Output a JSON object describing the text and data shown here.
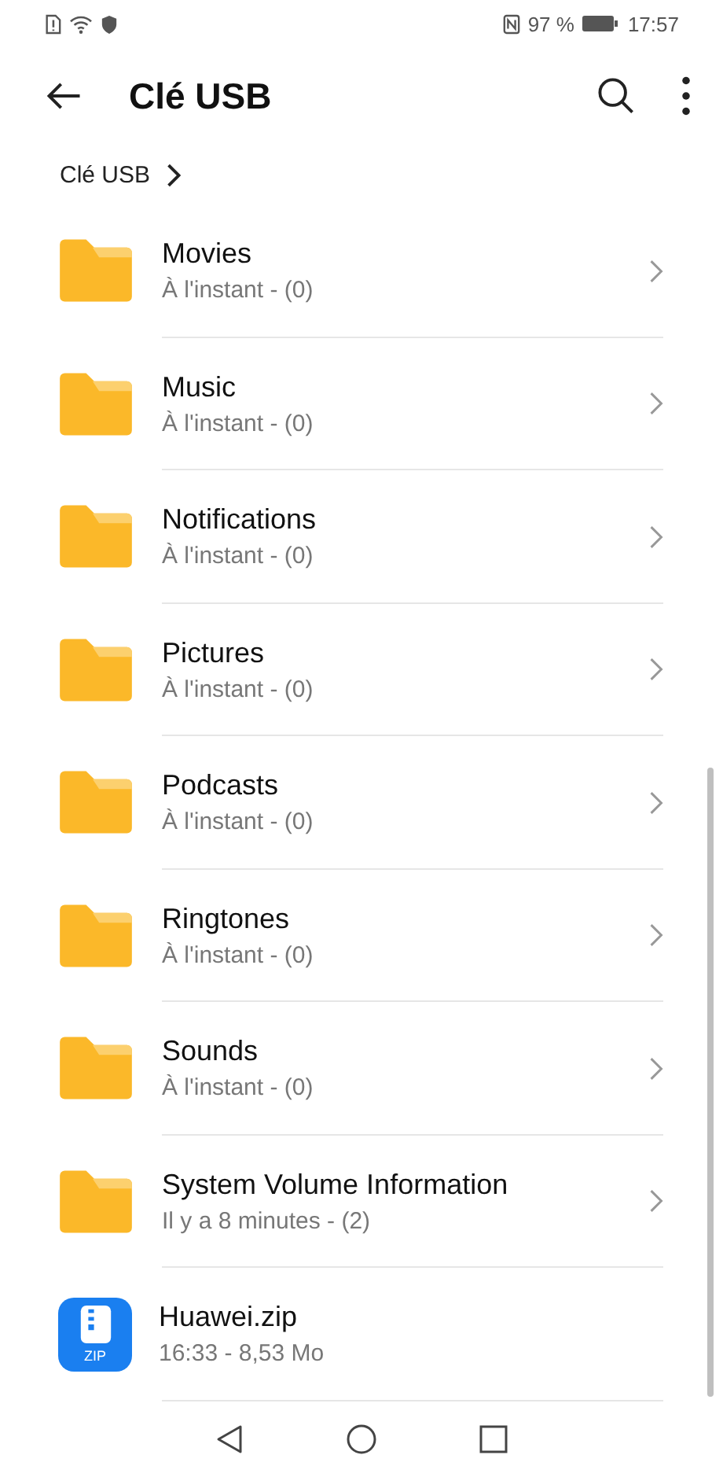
{
  "status_bar": {
    "battery_percent": "97 %",
    "time": "17:57"
  },
  "toolbar": {
    "title": "Clé USB"
  },
  "breadcrumb": [
    {
      "label": "Clé USB"
    }
  ],
  "items": [
    {
      "kind": "folder",
      "name": "Movies",
      "meta": "À l'instant - (0)"
    },
    {
      "kind": "folder",
      "name": "Music",
      "meta": "À l'instant - (0)"
    },
    {
      "kind": "folder",
      "name": "Notifications",
      "meta": "À l'instant - (0)"
    },
    {
      "kind": "folder",
      "name": "Pictures",
      "meta": "À l'instant - (0)"
    },
    {
      "kind": "folder",
      "name": "Podcasts",
      "meta": "À l'instant - (0)"
    },
    {
      "kind": "folder",
      "name": "Ringtones",
      "meta": "À l'instant - (0)"
    },
    {
      "kind": "folder",
      "name": "Sounds",
      "meta": "À l'instant - (0)"
    },
    {
      "kind": "folder",
      "name": "System Volume Information",
      "meta": "Il y a 8 minutes - (2)"
    },
    {
      "kind": "zip",
      "name": "Huawei.zip",
      "meta": "16:33 - 8,53  Mo",
      "icon_label": "ZIP"
    }
  ]
}
